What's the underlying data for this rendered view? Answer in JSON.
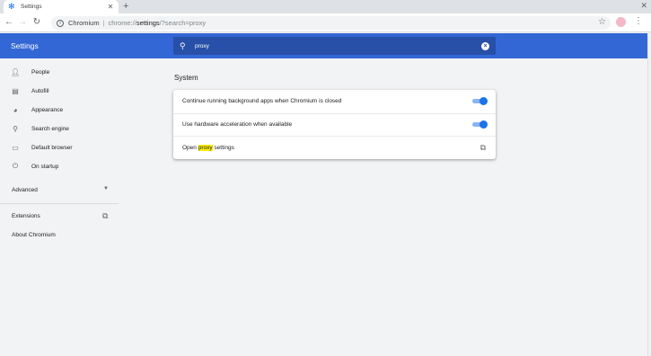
{
  "browser": {
    "tab_title": "Settings",
    "tab_favicon": "gear-icon",
    "new_tab_label": "+",
    "omnibox": {
      "host": "Chromium",
      "scheme": "chrome://",
      "path": "settings",
      "query": "/?search=proxy"
    }
  },
  "header": {
    "title": "Settings",
    "search_value": "proxy"
  },
  "sidebar": {
    "items": [
      {
        "label": "People",
        "icon": "person-icon"
      },
      {
        "label": "Autofill",
        "icon": "clipboard-icon"
      },
      {
        "label": "Appearance",
        "icon": "palette-icon"
      },
      {
        "label": "Search engine",
        "icon": "search-icon"
      },
      {
        "label": "Default browser",
        "icon": "browser-icon"
      },
      {
        "label": "On startup",
        "icon": "power-icon"
      }
    ],
    "advanced_label": "Advanced",
    "extensions_label": "Extensions",
    "about_label": "About Chromium"
  },
  "main": {
    "section_title": "System",
    "rows": [
      {
        "label": "Continue running background apps when Chromium is closed",
        "toggle_on": true
      },
      {
        "label": "Use hardware acceleration when available",
        "toggle_on": true
      },
      {
        "label_before": "Open ",
        "label_highlight": "proxy",
        "label_after": " settings",
        "icon": "open-in-new-icon"
      }
    ]
  },
  "colors": {
    "accent": "#3367d6",
    "toggle": "#1a73e8",
    "highlight": "#ffef00"
  }
}
